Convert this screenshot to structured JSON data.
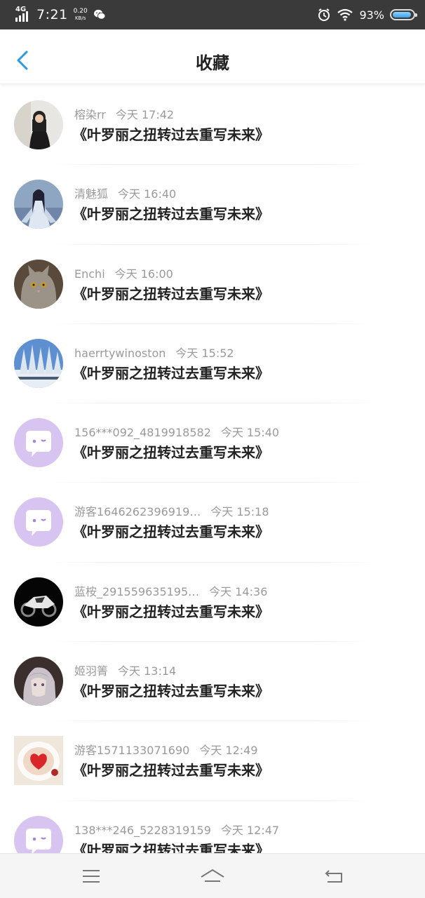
{
  "status_bar": {
    "network": "4G",
    "time": "7:21",
    "speed_value": "0.20",
    "speed_unit": "KB/s",
    "battery_pct": "93%",
    "icons": [
      "signal-icon",
      "wechat-icon",
      "alarm-icon",
      "wifi-icon",
      "battery-icon"
    ]
  },
  "header": {
    "title": "收藏",
    "back_icon": "chevron-left-icon",
    "accent_color": "#2a9be0"
  },
  "items": [
    {
      "username": "榕染rr",
      "time": "今天 17:42",
      "book": "《叶罗丽之扭转过去重写未来》",
      "avatar": "photo-girl"
    },
    {
      "username": "清魅狐",
      "time": "今天 16:40",
      "book": "《叶罗丽之扭转过去重写未来》",
      "avatar": "anime-character"
    },
    {
      "username": "Enchi",
      "time": "今天 16:00",
      "book": "《叶罗丽之扭转过去重写未来》",
      "avatar": "cat"
    },
    {
      "username": "haerrtywinoston",
      "time": "今天 15:52",
      "book": "《叶罗丽之扭转过去重写未来》",
      "avatar": "winter-trees"
    },
    {
      "username": "156***092_4819918582",
      "time": "今天 15:40",
      "book": "《叶罗丽之扭转过去重写未来》",
      "avatar": "default-chat"
    },
    {
      "username": "游客1646262396919…",
      "time": "今天 15:18",
      "book": "《叶罗丽之扭转过去重写未来》",
      "avatar": "default-chat"
    },
    {
      "username": "蓝桉_291559635195…",
      "time": "今天 14:36",
      "book": "《叶罗丽之扭转过去重写未来》",
      "avatar": "motorcycle"
    },
    {
      "username": "姬羽箐",
      "time": "今天 13:14",
      "book": "《叶罗丽之扭转过去重写未来》",
      "avatar": "anime-face"
    },
    {
      "username": "游客1571133071690",
      "time": "今天 12:49",
      "book": "《叶罗丽之扭转过去重写未来》",
      "avatar": "heart-latte"
    },
    {
      "username": "138***246_5228319159",
      "time": "今天 12:47",
      "book": "《叶罗丽之扭转过去重写未来》",
      "avatar": "default-chat"
    }
  ],
  "bottom_nav": {
    "icons": [
      "menu-icon",
      "home-icon",
      "back-icon"
    ]
  }
}
